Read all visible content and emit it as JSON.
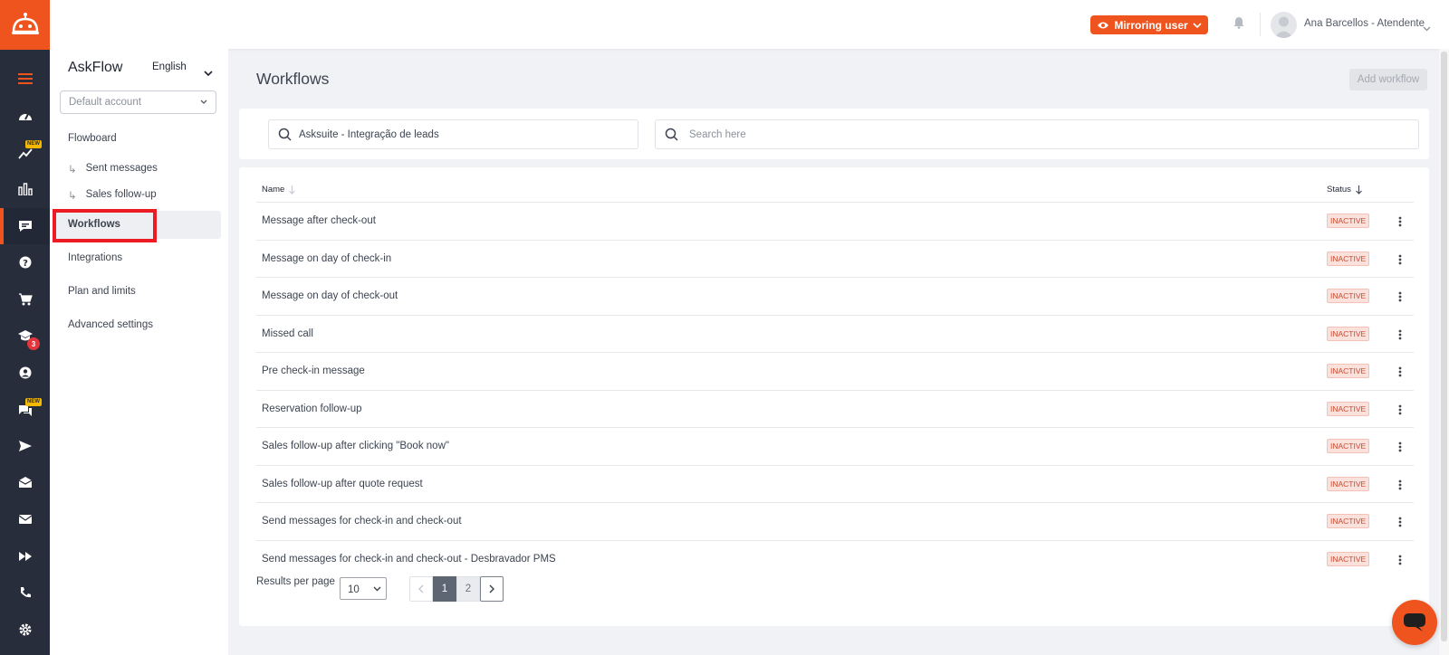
{
  "colors": {
    "brand": "#f0541e",
    "rail_bg": "#272d3a",
    "inactive_bg": "#fbe1db",
    "inactive_text": "#c84a2f",
    "highlight_box": "#ec1c24"
  },
  "rail": {
    "icons": [
      "bot-logo-icon",
      "hamburger-menu-icon",
      "dashboard-gauge-icon",
      "trending-icon",
      "bar-chart-icon",
      "chat-flow-icon",
      "help-circle-icon",
      "cart-icon",
      "graduation-cap-icon",
      "user-circle-icon",
      "chat-bubbles-icon",
      "send-icon",
      "inbox-icon",
      "mail-icon",
      "fast-forward-icon",
      "phone-icon",
      "settings-gear-icon"
    ],
    "new_badge": "NEW",
    "course_badge_count": "3"
  },
  "topbar": {
    "mirror_label": "Mirroring user",
    "user_name": "Ana Barcellos - Atendente"
  },
  "sidebar": {
    "app_name": "AskFlow",
    "language": "English",
    "account_placeholder": "Default account",
    "items": [
      {
        "label": "Flowboard"
      },
      {
        "label": "Sent messages"
      },
      {
        "label": "Sales follow-up"
      },
      {
        "label": "Workflows"
      },
      {
        "label": "Integrations"
      },
      {
        "label": "Plan and limits"
      },
      {
        "label": "Advanced settings"
      }
    ]
  },
  "main": {
    "title": "Workflows",
    "add_button": "Add workflow",
    "flow_filter": "Asksuite - Integração de leads",
    "search_placeholder": "Search here",
    "columns": {
      "name": "Name",
      "status": "Status"
    },
    "rows": [
      {
        "name": "Message after check-out",
        "status": "INACTIVE"
      },
      {
        "name": "Message on day of check-in",
        "status": "INACTIVE"
      },
      {
        "name": "Message on day of check-out",
        "status": "INACTIVE"
      },
      {
        "name": "Missed call",
        "status": "INACTIVE"
      },
      {
        "name": "Pre check-in message",
        "status": "INACTIVE"
      },
      {
        "name": "Reservation follow-up",
        "status": "INACTIVE"
      },
      {
        "name": "Sales follow-up after clicking \"Book now\"",
        "status": "INACTIVE"
      },
      {
        "name": "Sales follow-up after quote request",
        "status": "INACTIVE"
      },
      {
        "name": "Send messages for check-in and check-out",
        "status": "INACTIVE"
      },
      {
        "name": "Send messages for check-in and check-out - Desbravador PMS",
        "status": "INACTIVE"
      }
    ],
    "results_per_page_label": "Results per page",
    "results_per_page_value": "10",
    "pages": [
      "1",
      "2"
    ]
  }
}
